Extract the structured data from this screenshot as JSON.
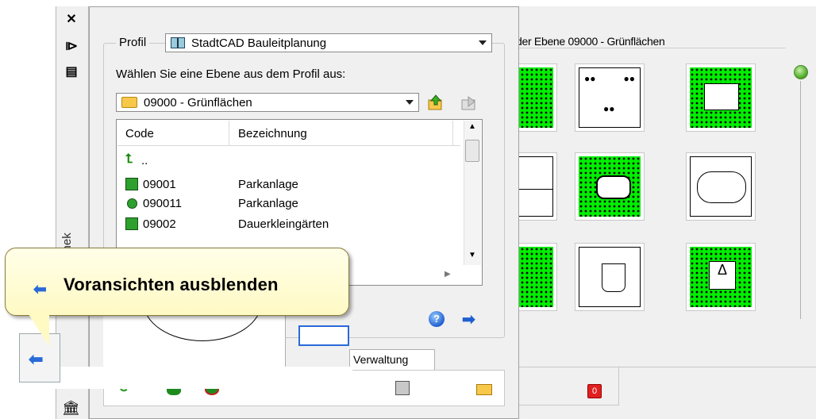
{
  "toolbar_left": {
    "close_glyph": "✕",
    "pin_glyph": "⧐",
    "props_glyph": "▤",
    "vertical_label": "othek"
  },
  "profile": {
    "label": "Profil",
    "selected": "StadtCAD Bauleitplanung"
  },
  "layer": {
    "instruction": "Wählen Sie eine Ebene aus dem Profil aus:",
    "selected": "09000 - Grünflächen"
  },
  "list": {
    "headers": {
      "code": "Code",
      "bezeichnung": "Bezeichnung"
    },
    "up_label": "..",
    "rows": [
      {
        "code": "09001",
        "bezeichnung": "Parkanlage",
        "icon": "green-square-icon"
      },
      {
        "code": "090011",
        "bezeichnung": "Parkanlage",
        "icon": "green-circle-icon"
      },
      {
        "code": "09002",
        "bezeichnung": "Dauerkleingärten",
        "icon": "green-square-icon"
      }
    ]
  },
  "tabs": {
    "verwaltung": "Verwaltung"
  },
  "preview": {
    "header": "der Ebene 09000 - Grünflächen"
  },
  "tooltip": {
    "text": "Voransichten ausblenden"
  },
  "colors": {
    "accent_blue": "#1f5fd0",
    "green_fill": "#00ee00",
    "tooltip_bg": "#fff9c4"
  }
}
